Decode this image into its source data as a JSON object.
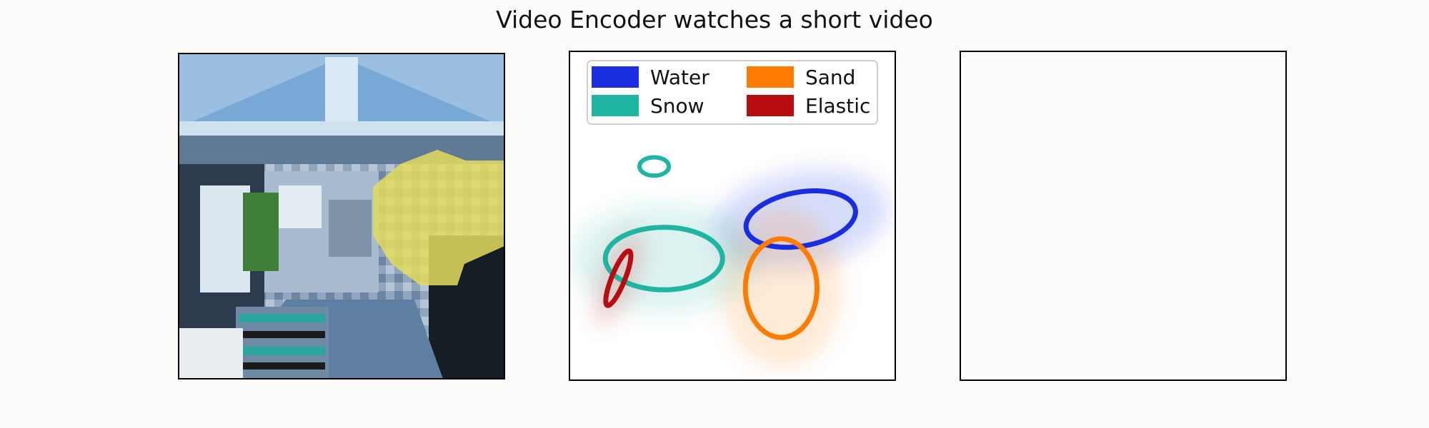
{
  "title": "Video Encoder watches a short video",
  "chart_data": {
    "type": "density-contour",
    "title": "Video Encoder watches a short video",
    "panels": [
      {
        "kind": "video-frame",
        "overlay_color": "#e4dc5e"
      },
      {
        "kind": "density-contours",
        "legend_placement": "top",
        "grid": false
      },
      {
        "kind": "empty"
      }
    ],
    "xlim": [
      0,
      10
    ],
    "ylim": [
      0,
      10
    ],
    "series": [
      {
        "name": "Water",
        "color": "#1a2ee0",
        "center": [
          7.1,
          4.9
        ],
        "rx": 1.7,
        "ry": 0.82,
        "rotation": -10
      },
      {
        "name": "Sand",
        "color": "#ff7c00",
        "center": [
          6.5,
          2.8
        ],
        "rx": 1.1,
        "ry": 1.5,
        "rotation": 0
      },
      {
        "name": "Snow",
        "color": "#1fb5a2",
        "center": [
          2.9,
          3.7
        ],
        "rx": 1.8,
        "ry": 0.95,
        "rotation": 0
      },
      {
        "name": "Elastic",
        "color": "#b80d10",
        "center": [
          1.5,
          3.1
        ],
        "rx": 0.9,
        "ry": 0.2,
        "rotation": -68
      }
    ],
    "legend": [
      "Water",
      "Sand",
      "Snow",
      "Elastic"
    ]
  }
}
